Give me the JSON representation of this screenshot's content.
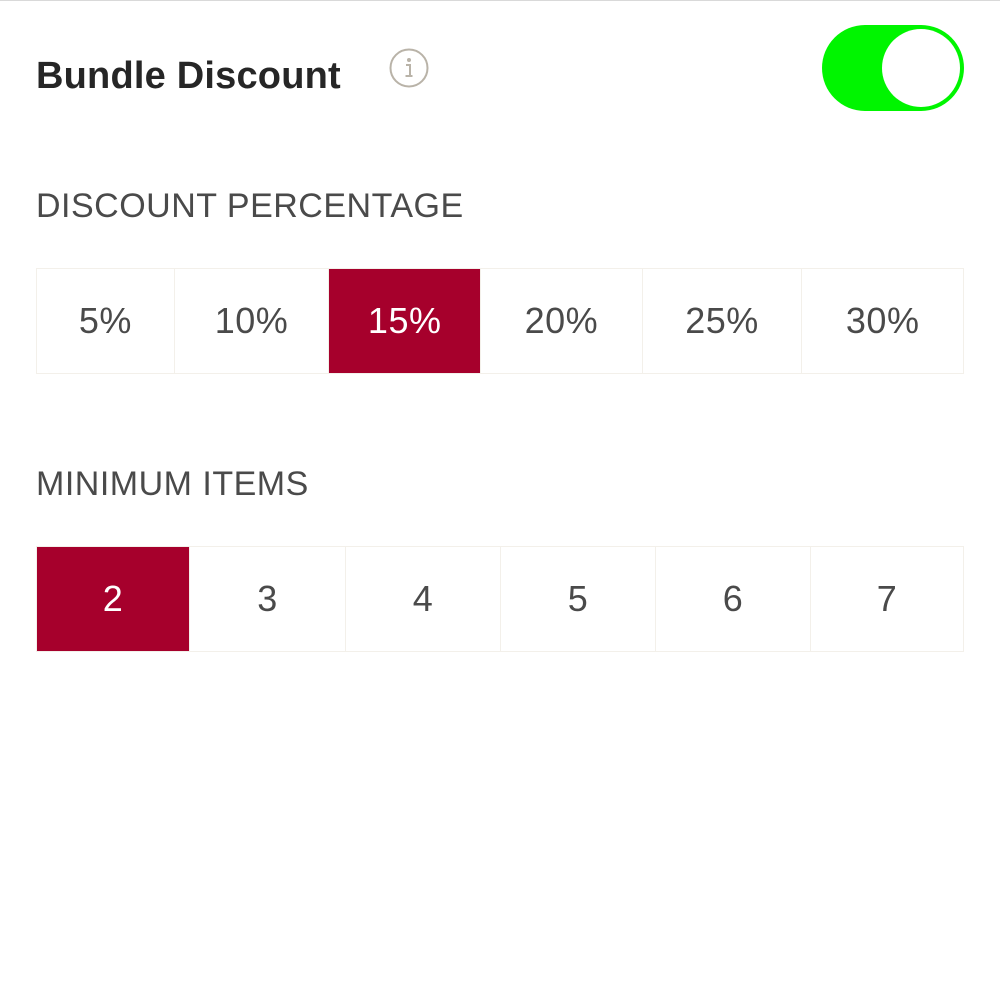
{
  "header": {
    "title": "Bundle Discount",
    "info_icon": "info-circle-icon",
    "toggle_on": true,
    "toggle_color": "#00f500"
  },
  "discount": {
    "label": "DISCOUNT PERCENTAGE",
    "options": [
      "5%",
      "10%",
      "15%",
      "20%",
      "25%",
      "30%"
    ],
    "selected": "15%"
  },
  "min_items": {
    "label": "MINIMUM ITEMS",
    "options": [
      "2",
      "3",
      "4",
      "5",
      "6",
      "7"
    ],
    "selected": "2"
  },
  "colors": {
    "selected_bg": "#a6002c",
    "selected_text": "#ffffff",
    "text": "#4a4a4a",
    "border": "#f3f0ea"
  }
}
